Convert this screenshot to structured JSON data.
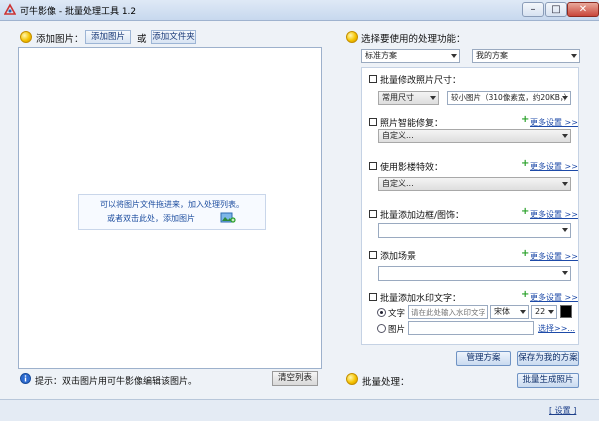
{
  "window": {
    "title": "可牛影像 - 批量处理工具 1.2",
    "buttons": {
      "minimize": "–",
      "maximize": "□",
      "close": "✕"
    }
  },
  "left": {
    "add_label": "添加图片：",
    "add_image_button": "添加图片",
    "or_text": "或",
    "add_folder_button": "添加文件夹",
    "drop_hint_line1": "可以将图片文件拖进来，加入处理列表。",
    "drop_hint_line2": "或者双击此处，添加图片",
    "tip_text": "提示：双击图片用可牛影像编辑该图片。",
    "clear_button": "清空列表"
  },
  "right": {
    "header": "选择要使用的处理功能：",
    "preset_select": "标准方案",
    "my_preset_select": "我的方案",
    "sections": [
      {
        "label": "批量修改照片尺寸：",
        "link": ""
      },
      {
        "label": "照片智能修复：",
        "link": "更多设置 >>"
      },
      {
        "label": "使用影楼特效：",
        "link": "更多设置 >>"
      },
      {
        "label": "批量添加边框/图饰：",
        "link": "更多设置 >>"
      },
      {
        "label": "添加场景",
        "link": "更多设置 >>"
      },
      {
        "label": "批量添加水印文字：",
        "link": "更多设置 >>"
      }
    ],
    "size_select": "常用尺寸",
    "size_detail_select": "较小图片（310像素宽，约20KB，）",
    "repair_select": "自定义...",
    "effect_select": "自定义...",
    "border_select": "",
    "scene_select": "",
    "watermark": {
      "text_radio": "文字",
      "text_placeholder": "请在此处输入水印文字",
      "font_select": "宋体",
      "size_select": "22",
      "color": "#000000",
      "image_radio": "图片",
      "browse_link": "选择>>..."
    },
    "manage_button": "管理方案",
    "save_button": "保存为我的方案",
    "batch_label": "批量处理：",
    "batch_button": "批量生成照片"
  },
  "status": {
    "settings_link": "[ 设置 ]"
  }
}
